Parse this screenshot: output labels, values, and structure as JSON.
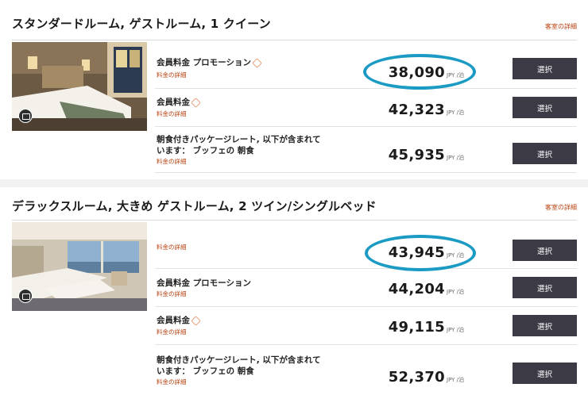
{
  "common": {
    "room_details_label": "客室の詳細",
    "rate_details_label": "料金の詳細",
    "select_label": "選択",
    "unit_label": "JPY /泊"
  },
  "rooms": [
    {
      "title": "スタンダードルーム, ゲストルーム, 1 クイーン",
      "rates": [
        {
          "name": "会員料金 プロモーション",
          "price": "38,090",
          "highlighted": true
        },
        {
          "name": "会員料金",
          "price": "42,323"
        },
        {
          "name_line1": "朝食付きパッケージレート, 以下が含まれて",
          "name_line2": "います： ブッフェの 朝食",
          "price": "45,935"
        }
      ]
    },
    {
      "title": "デラックスルーム, 大きめ ゲストルーム, 2 ツイン/シングルベッド",
      "rates": [
        {
          "name": "",
          "price": "43,945",
          "highlighted": true
        },
        {
          "name": "会員料金 プロモーション",
          "price": "44,204"
        },
        {
          "name": "会員料金",
          "price": "49,115"
        },
        {
          "name_line1": "朝食付きパッケージレート, 以下が含まれて",
          "name_line2": "います： ブッフェの 朝食",
          "price": "52,370"
        }
      ]
    }
  ],
  "colors": {
    "accent_link": "#b8410f",
    "button_bg": "#3b3a45",
    "highlight_ring": "#1b9bc4"
  }
}
